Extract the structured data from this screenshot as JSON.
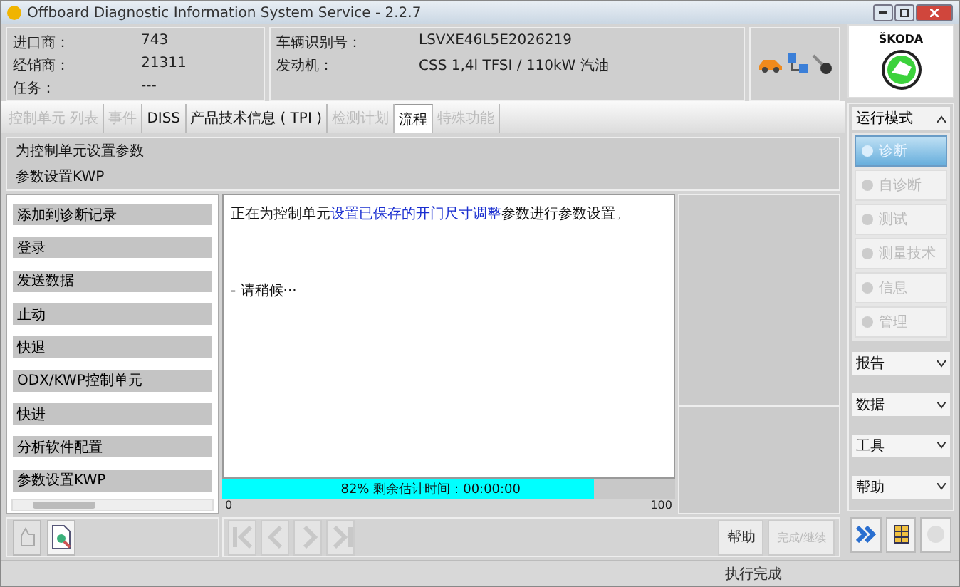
{
  "window": {
    "title": "Offboard Diagnostic Information System Service - 2.2.7"
  },
  "header": {
    "left": [
      {
        "label": "进口商：",
        "value": "743"
      },
      {
        "label": "经销商：",
        "value": "21311"
      },
      {
        "label": "任务：",
        "value": "---"
      }
    ],
    "right": [
      {
        "label": "车辆识别号：",
        "value": "LSVXE46L5E2026219"
      },
      {
        "label": "发动机：",
        "value": "CSS 1,4l TFSI / 110kW 汽油"
      }
    ]
  },
  "brand": {
    "name": "ŠKODA"
  },
  "tabs": [
    {
      "label": "控制单元 列表",
      "selected": false,
      "disabled": true
    },
    {
      "label": "事件",
      "selected": false,
      "disabled": true
    },
    {
      "label": "DISS",
      "selected": false,
      "disabled": false
    },
    {
      "label": "产品技术信息 ( TPI )",
      "selected": false,
      "disabled": false
    },
    {
      "label": "检测计划",
      "selected": false,
      "disabled": true
    },
    {
      "label": "流程",
      "selected": true,
      "disabled": false
    },
    {
      "label": "特殊功能",
      "selected": false,
      "disabled": true
    }
  ],
  "breadcrumb": [
    "为控制单元设置参数",
    "参数设置KWP"
  ],
  "steps": [
    "添加到诊断记录",
    "登录",
    "发送数据",
    "止动",
    "快退",
    "ODX/KWP控制单元",
    "快进",
    "分析软件配置",
    "参数设置KWP"
  ],
  "message": [
    {
      "text": "正在为控制单元",
      "highlight": false
    },
    {
      "text": "设置已保存的开门尺寸调整",
      "highlight": true
    },
    {
      "text": "参数进行参数设置。",
      "highlight": false
    }
  ],
  "wait_text": "- 请稍候···",
  "progress": {
    "level": 0.82,
    "text": "82% 剩余估计时间：00:00:00",
    "min": "0",
    "max": "100"
  },
  "nav_buttons": [
    {
      "kind": "first",
      "disabled": true
    },
    {
      "kind": "prev",
      "disabled": true
    },
    {
      "kind": "next",
      "disabled": true
    },
    {
      "kind": "last",
      "disabled": true
    }
  ],
  "action_buttons": [
    {
      "label": "帮助",
      "disabled": false
    },
    {
      "label": "完成/继续",
      "disabled": true
    }
  ],
  "mode_panel": {
    "title": "运行模式",
    "items": [
      {
        "label": "诊断",
        "selected": true
      },
      {
        "label": "自诊断",
        "selected": false
      },
      {
        "label": "测试",
        "selected": false
      },
      {
        "label": "测量技术",
        "selected": false
      },
      {
        "label": "信息",
        "selected": false
      },
      {
        "label": "管理",
        "selected": false
      }
    ],
    "sections": [
      "报告",
      "数据",
      "工具",
      "帮助"
    ]
  },
  "status_bar": {
    "text": "执行完成"
  }
}
